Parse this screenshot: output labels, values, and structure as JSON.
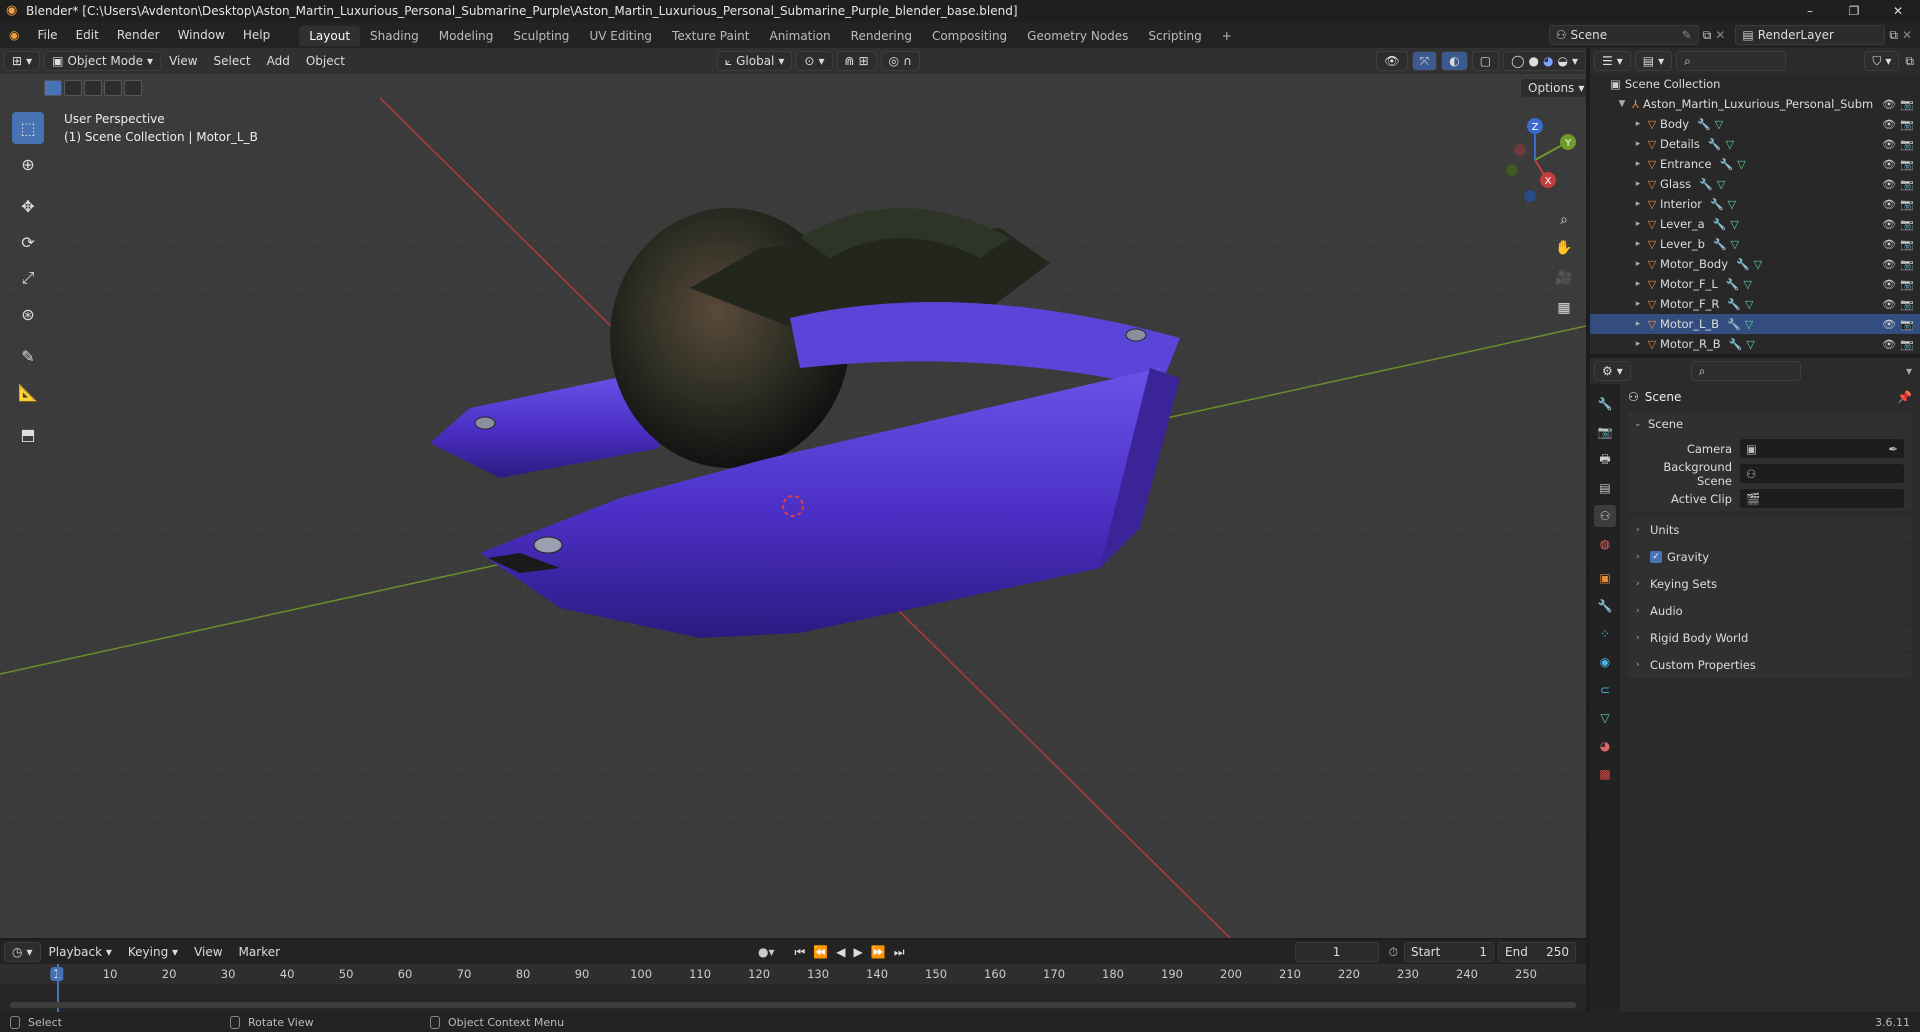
{
  "window": {
    "title": "Blender* [C:\\Users\\Avdenton\\Desktop\\Aston_Martin_Luxurious_Personal_Submarine_Purple\\Aston_Martin_Luxurious_Personal_Submarine_Purple_blender_base.blend]",
    "controls": [
      "–",
      "❐",
      "✕"
    ]
  },
  "menu": [
    "File",
    "Edit",
    "Render",
    "Window",
    "Help"
  ],
  "workspaces": [
    "Layout",
    "Shading",
    "Modeling",
    "Sculpting",
    "UV Editing",
    "Texture Paint",
    "Animation",
    "Rendering",
    "Compositing",
    "Geometry Nodes",
    "Scripting"
  ],
  "add_workspace": "+",
  "scene_name": "Scene",
  "view_layer": "RenderLayer",
  "viewport": {
    "mode": "Object Mode",
    "menus": [
      "View",
      "Select",
      "Add",
      "Object"
    ],
    "orientation": "Global",
    "options": "Options",
    "perspective": "User Perspective",
    "context": "(1) Scene Collection | Motor_L_B",
    "gizmo_axes": {
      "z": "Z",
      "y": "Y",
      "x": "X"
    }
  },
  "outliner": {
    "root": "Scene Collection",
    "collection": "Aston_Martin_Luxurious_Personal_Subm",
    "objects": [
      "Body",
      "Details",
      "Entrance",
      "Glass",
      "Interior",
      "Lever_a",
      "Lever_b",
      "Motor_Body",
      "Motor_F_L",
      "Motor_F_R",
      "Motor_L_B",
      "Motor_R_B"
    ],
    "selected": "Motor_L_B"
  },
  "properties": {
    "header": "Scene",
    "panel": "Scene",
    "rows": [
      {
        "label": "Camera",
        "value": ""
      },
      {
        "label": "Background Scene",
        "value": ""
      },
      {
        "label": "Active Clip",
        "value": ""
      }
    ],
    "sections": [
      "Units",
      "Gravity",
      "Keying Sets",
      "Audio",
      "Rigid Body World",
      "Custom Properties"
    ],
    "gravity_checked": true
  },
  "timeline": {
    "menus": [
      "Playback",
      "Keying",
      "View",
      "Marker"
    ],
    "current_frame": "1",
    "start_label": "Start",
    "start": "1",
    "end_label": "End",
    "end": "250",
    "ruler": [
      "1",
      "10",
      "20",
      "30",
      "40",
      "50",
      "60",
      "70",
      "80",
      "90",
      "100",
      "110",
      "120",
      "130",
      "140",
      "150",
      "160",
      "170",
      "180",
      "190",
      "200",
      "210",
      "220",
      "230",
      "240",
      "250"
    ]
  },
  "status": {
    "items": [
      "Select",
      "Rotate View",
      "Object Context Menu"
    ],
    "version": "3.6.11"
  },
  "colors": {
    "accent": "#4772b3",
    "hull": "#4a2fc0",
    "x_axis": "#c43c3c",
    "y_axis": "#6f9a2c"
  }
}
